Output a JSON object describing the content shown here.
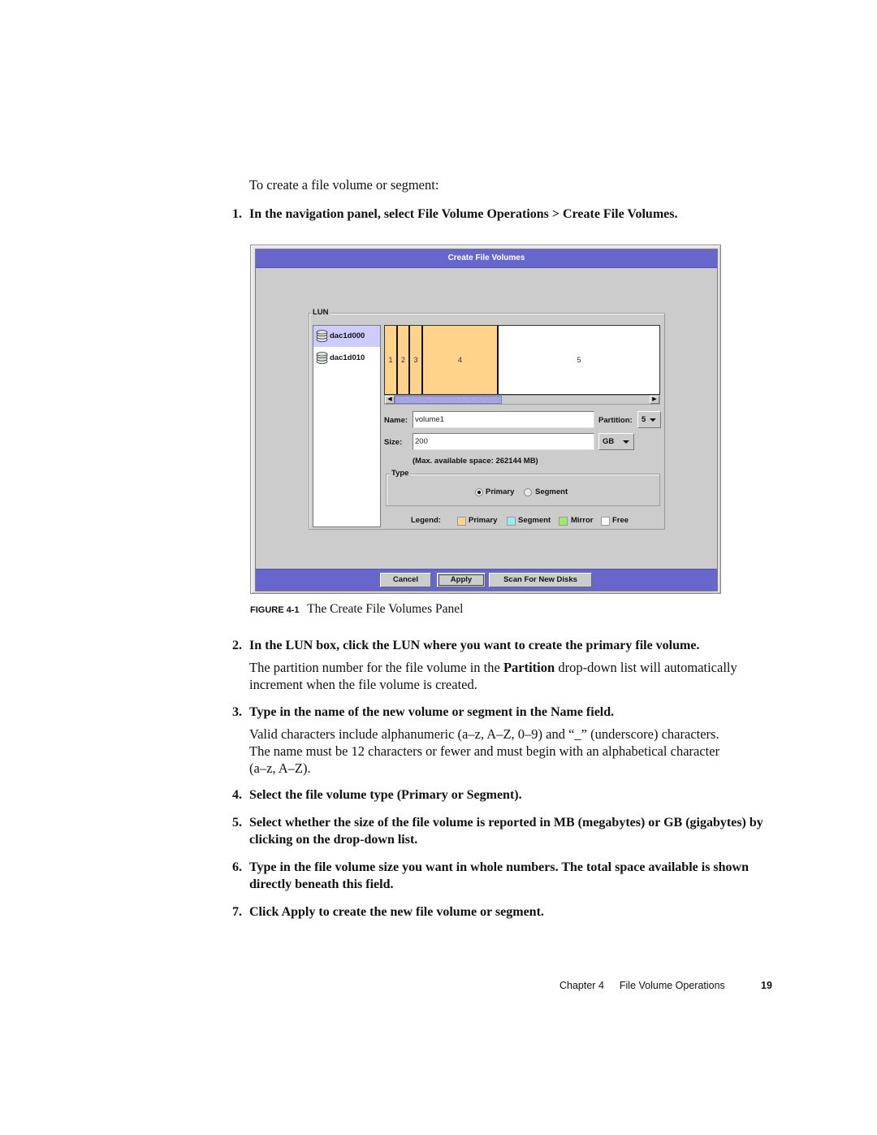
{
  "intro": "To create a file volume or segment:",
  "steps": [
    {
      "num": "1.",
      "text": "In the navigation panel, select File Volume Operations > Create File Volumes."
    },
    {
      "num": "2.",
      "text": "In the LUN box, click the LUN where you want to create the primary file volume."
    },
    {
      "num": "3.",
      "text": "Type in the name of the new volume or segment in the Name field."
    },
    {
      "num": "4.",
      "text": "Select the file volume type (Primary or Segment)."
    },
    {
      "num": "5.",
      "text": "Select whether the size of the file volume is reported in MB (megabytes) or GB (gigabytes) by clicking on the drop-down list."
    },
    {
      "num": "6.",
      "text": "Type in the file volume size you want in whole numbers. The total space available is shown directly beneath this field."
    },
    {
      "num": "7.",
      "text": "Click Apply to create the new file volume or segment."
    }
  ],
  "para2": {
    "before": "The partition number for the file volume in the ",
    "bold": "Partition",
    "after": " drop-down list will automatically increment when the file volume is created."
  },
  "para3": "Valid characters include alphanumeric (a–z, A–Z, 0–9) and “_” (underscore) characters. The name must be 12 characters or fewer and must begin with an alphabetical character (a–z, A–Z).",
  "figure": {
    "label": "FIGURE 4-1",
    "caption": "The Create File Volumes Panel"
  },
  "panel": {
    "title": "Create File Volumes",
    "lun_group_title": "LUN",
    "luns": [
      {
        "name": "dac1d000",
        "icon": "disk-stack-icon",
        "selected": true
      },
      {
        "name": "dac1d010",
        "icon": "disk-stack-icon",
        "selected": false
      }
    ],
    "partitions": [
      {
        "label": "1",
        "type": "Primary"
      },
      {
        "label": "2",
        "type": "Primary"
      },
      {
        "label": "3",
        "type": "Primary"
      },
      {
        "label": "4",
        "type": "Primary"
      },
      {
        "label": "5",
        "type": "Free"
      }
    ],
    "name_label": "Name:",
    "name_value": "volume1",
    "partition_label": "Partition:",
    "partition_value": "5",
    "size_label": "Size:",
    "size_value": "200",
    "unit_value": "GB",
    "max_space": "(Max. available space: 262144 MB)",
    "type_group_title": "Type",
    "type_options": [
      {
        "label": "Primary",
        "checked": true
      },
      {
        "label": "Segment",
        "checked": false
      }
    ],
    "legend_label": "Legend:",
    "legend": [
      {
        "label": "Primary",
        "color": "#ffd38a"
      },
      {
        "label": "Segment",
        "color": "#9ee8ee"
      },
      {
        "label": "Mirror",
        "color": "#99ee66"
      },
      {
        "label": "Free",
        "color": "#ffffff"
      }
    ],
    "buttons": {
      "cancel": "Cancel",
      "apply": "Apply",
      "scan": "Scan For New Disks"
    },
    "colors": {
      "titlebar": "#6666cc",
      "background": "#cccccc",
      "selection": "#ccccff",
      "primary": "#ffd38a"
    }
  },
  "footer": {
    "chapter": "Chapter 4",
    "section": "File Volume Operations",
    "page": "19"
  }
}
